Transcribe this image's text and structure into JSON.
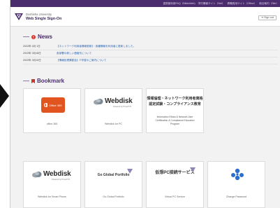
{
  "topbar": {
    "links": [
      "図書館利用FAQ（BiblioWeb)",
      "学内情報サイト（Net）",
      "教職員用サイト（Office）",
      "総合案内（Site）"
    ]
  },
  "header": {
    "university": "Doshisha University",
    "title": "Web Single Sign-On",
    "signout_label": "Sign out"
  },
  "news": {
    "title": "News",
    "items": [
      {
        "date": "2022年 4月 1日",
        "text": "【ネットワーク利用者情報更新】・各種情報を利用者に更新しました。"
      },
      {
        "date": "2022年 3月18日",
        "text": "各部署の新しい連絡先について"
      },
      {
        "date": "2022年 3月10日",
        "text": "【情報処理講習会】IT学習のご案内について"
      }
    ]
  },
  "bookmark": {
    "title": "Bookmark",
    "tiles": [
      {
        "id": "office365",
        "logo_text": "Office 365",
        "label": "office 365"
      },
      {
        "id": "webdisk-pc",
        "logo_text": "Webdisk",
        "logo_sub": "Powered by Proself v5",
        "label": "Webdisk for PC"
      },
      {
        "id": "infosec",
        "title_line1": "情報倫理・ネットワーク利用者資格",
        "title_line2": "認定試験・コンプライアンス教育",
        "label_line1": "Information Ethics & Network User",
        "label_line2": "Certification & Compliance Education",
        "label_line3": "Program"
      },
      {
        "id": "webdisk-phone",
        "logo_text": "Webdisk",
        "logo_sub": "Powered by Proself v5",
        "label": "Webdisk for Smart Phone"
      },
      {
        "id": "portfolio",
        "logo_text": "Go Global Portfolio",
        "label": "Go Global Portfolio"
      },
      {
        "id": "vpc",
        "logo_text": "仮想PC接続サービス",
        "label": "Virtual PC Service"
      },
      {
        "id": "password",
        "label": "Change Password"
      }
    ]
  },
  "colors": {
    "brand": "#4b2d6e",
    "link": "#2b63b0",
    "office": "#e2541f",
    "news_icon": "#d9342b",
    "bookmark_icon": "#c0392b",
    "password_icon": "#2a6fd0"
  }
}
